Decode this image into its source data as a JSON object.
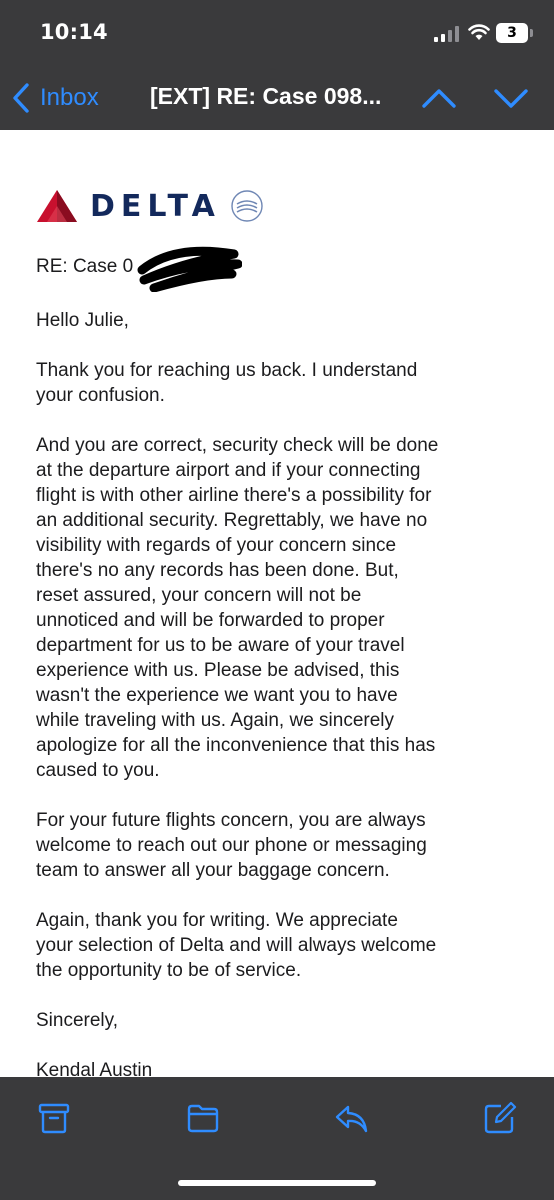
{
  "status_bar": {
    "time": "10:14",
    "battery_level": "3"
  },
  "nav": {
    "back_label": "Inbox",
    "title": "[EXT] RE: Case 098..."
  },
  "email": {
    "logo_text": "DELTA",
    "subject_line": "RE: Case 0",
    "paragraphs": [
      "Hello Julie,",
      "Thank you for reaching us back. I understand\nyour confusion.",
      "And you are correct, security check will be done\nat the departure airport and if your connecting\nflight is with other airline there's a possibility for\nan additional security. Regrettably, we have no\nvisibility with regards of your concern since\nthere's no any records has been done. But,\nreset assured, your concern will not be\nunnoticed and will be forwarded to proper\ndepartment for us to be aware of your travel\nexperience with us. Please be advised, this\nwasn't the experience we want you to have\nwhile traveling with us. Again, we sincerely\napologize for all the inconvenience that this has\ncaused to you.",
      "For your future flights concern, you are always\nwelcome to reach out our phone or messaging\nteam to answer all your baggage concern.",
      "Again, thank you for writing. We appreciate\nyour selection of Delta and will always welcome\nthe opportunity to be of service.",
      "Sincerely,",
      "Kendal Austin"
    ]
  },
  "colors": {
    "accent": "#2f8cff",
    "header_bg": "#3a3a3c",
    "delta_navy": "#13295c",
    "delta_red": "#c8102e"
  },
  "icons": {
    "toolbar": [
      "archive-icon",
      "folder-icon",
      "reply-icon",
      "compose-icon"
    ]
  }
}
